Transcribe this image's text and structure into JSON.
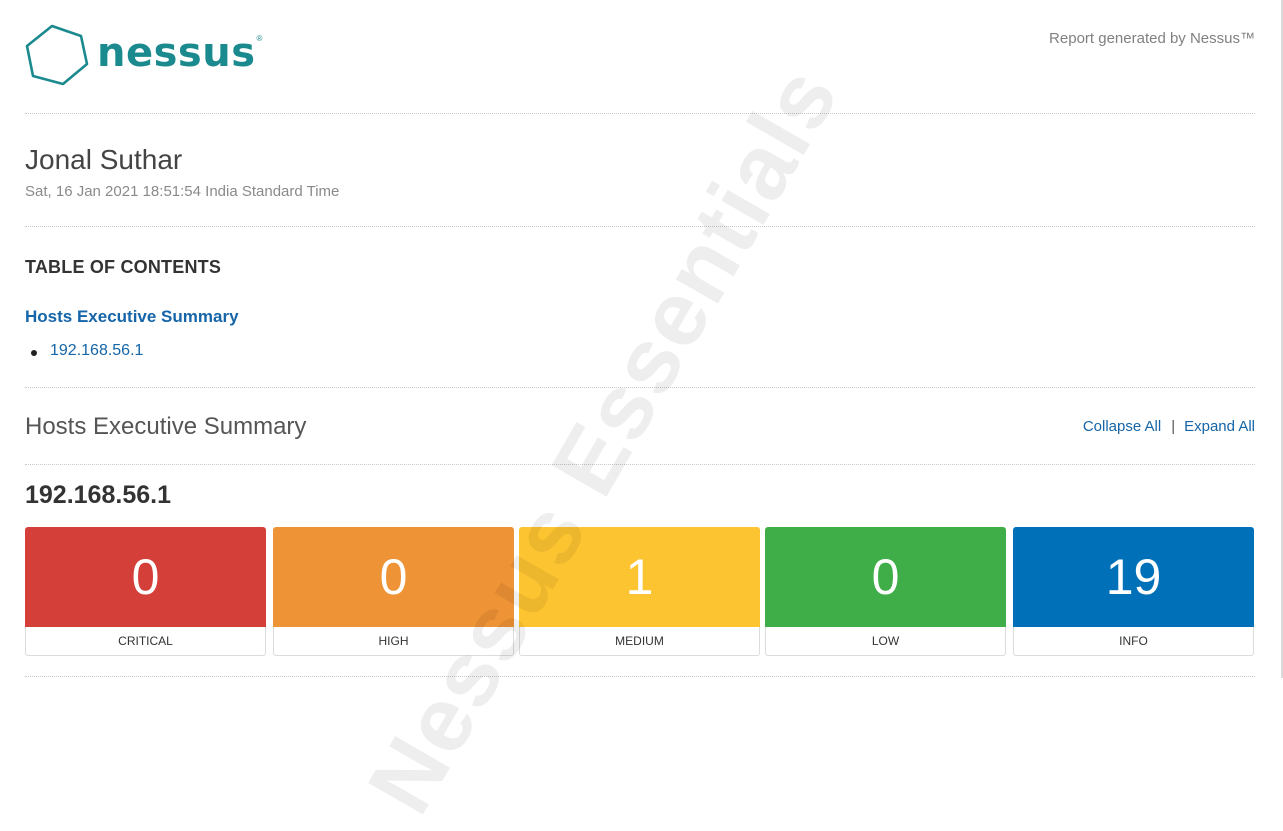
{
  "header": {
    "logo_text": "nessus",
    "logo_tm": "®",
    "generated_text": "Report generated by Nessus™"
  },
  "report": {
    "title": "Jonal Suthar",
    "date": "Sat, 16 Jan 2021 18:51:54 India Standard Time"
  },
  "toc": {
    "heading": "TABLE OF CONTENTS",
    "section_link": "Hosts Executive Summary",
    "hosts": [
      "192.168.56.1"
    ]
  },
  "summary": {
    "title": "Hosts Executive Summary",
    "collapse_label": "Collapse All",
    "separator": "|",
    "expand_label": "Expand All"
  },
  "host": {
    "ip": "192.168.56.1",
    "severities": [
      {
        "label": "CRITICAL",
        "count": "0",
        "color": "#d43f3a"
      },
      {
        "label": "HIGH",
        "count": "0",
        "color": "#ee9336"
      },
      {
        "label": "MEDIUM",
        "count": "1",
        "color": "#fdc431"
      },
      {
        "label": "LOW",
        "count": "0",
        "color": "#3fae49"
      },
      {
        "label": "INFO",
        "count": "19",
        "color": "#0071b9"
      }
    ]
  },
  "watermark": "Nessus Essentials",
  "colors": {
    "brand": "#1a8a8f",
    "link": "#1565a8"
  }
}
